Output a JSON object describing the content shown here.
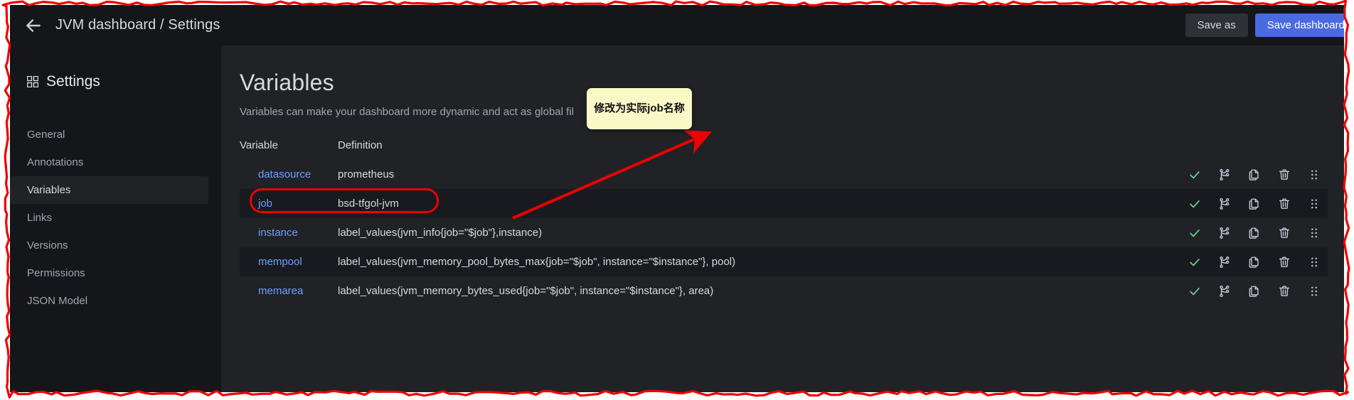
{
  "window": {
    "back_icon": "arrow-left-icon",
    "breadcrumb": "JVM dashboard / Settings",
    "save_as_label": "Save as",
    "save_dashboard_label": "Save dashboard"
  },
  "sidebar": {
    "icon": "apps-grid-icon",
    "title": "Settings",
    "items": [
      {
        "label": "General",
        "active": false
      },
      {
        "label": "Annotations",
        "active": false
      },
      {
        "label": "Variables",
        "active": true
      },
      {
        "label": "Links",
        "active": false
      },
      {
        "label": "Versions",
        "active": false
      },
      {
        "label": "Permissions",
        "active": false
      },
      {
        "label": "JSON Model",
        "active": false
      }
    ]
  },
  "main": {
    "title": "Variables",
    "subtitle": "Variables can make your dashboard more dynamic and act as global fil",
    "columns": {
      "variable": "Variable",
      "definition": "Definition"
    },
    "rows": [
      {
        "name": "datasource",
        "definition": "prometheus"
      },
      {
        "name": "job",
        "definition": "bsd-tfgol-jvm"
      },
      {
        "name": "instance",
        "definition": "label_values(jvm_info{job=\"$job\"},instance)"
      },
      {
        "name": "mempool",
        "definition": "label_values(jvm_memory_pool_bytes_max{job=\"$job\", instance=\"$instance\"}, pool)"
      },
      {
        "name": "memarea",
        "definition": "label_values(jvm_memory_bytes_used{job=\"$job\", instance=\"$instance\"}, area)"
      }
    ],
    "row_actions": [
      "check-icon",
      "show-usages-icon",
      "duplicate-icon",
      "trash-icon",
      "drag-handle-icon"
    ]
  },
  "annotations": {
    "note_text": "修改为实际job名称",
    "note_color": "#fbf8c8",
    "arrow_color": "#ee0000",
    "highlight_color": "#ee0000",
    "highlight_target": "job"
  },
  "colors": {
    "app_bg": "#141619",
    "panel_bg": "#202226",
    "row_alt_bg": "#181a1f",
    "accent_blue": "#4a6ae0",
    "link_blue": "#6e9fff",
    "active_orange": "#f55f3e",
    "check_green": "#6ccf8e",
    "text_primary": "#d8d9da",
    "text_muted": "#9fa7b3"
  }
}
